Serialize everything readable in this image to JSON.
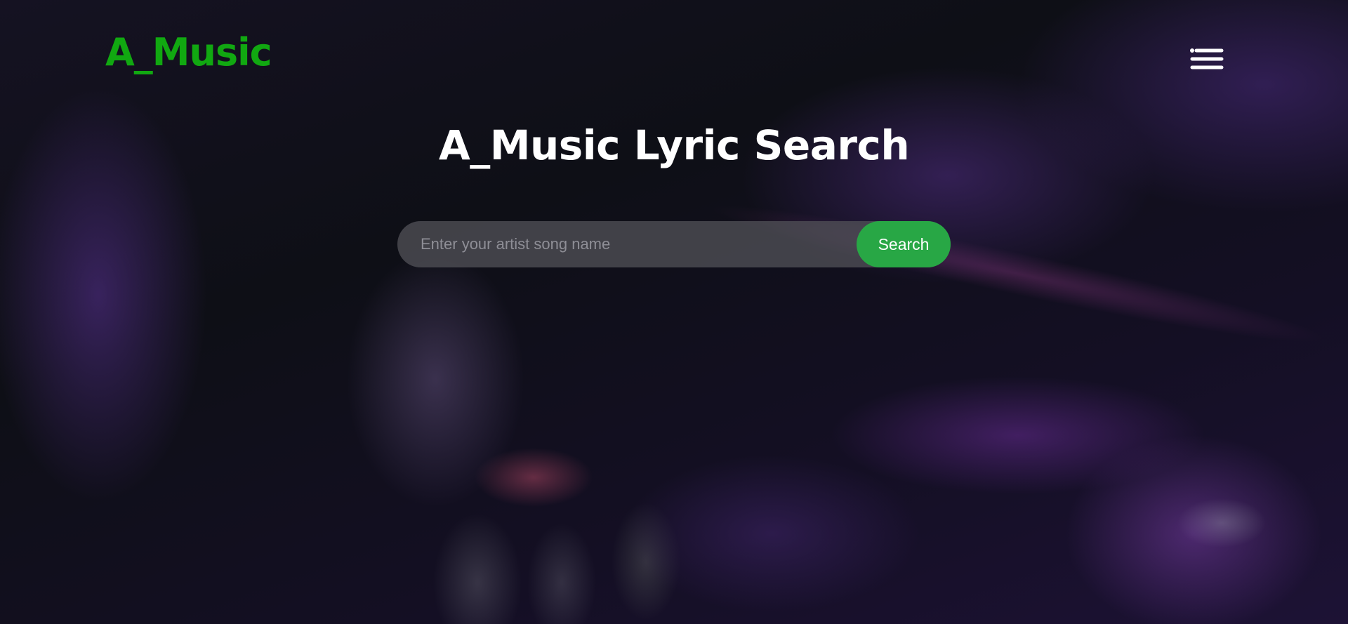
{
  "header": {
    "logo_text": "A_Music",
    "menu_icon": "hamburger-menu-icon"
  },
  "main": {
    "title": "A_Music Lyric Search",
    "search": {
      "placeholder": "Enter your artist song name",
      "value": "",
      "button_label": "Search"
    }
  },
  "colors": {
    "brand": "#11a811",
    "button": "#28a745",
    "background": "#0f0f17",
    "text": "#ffffff"
  }
}
